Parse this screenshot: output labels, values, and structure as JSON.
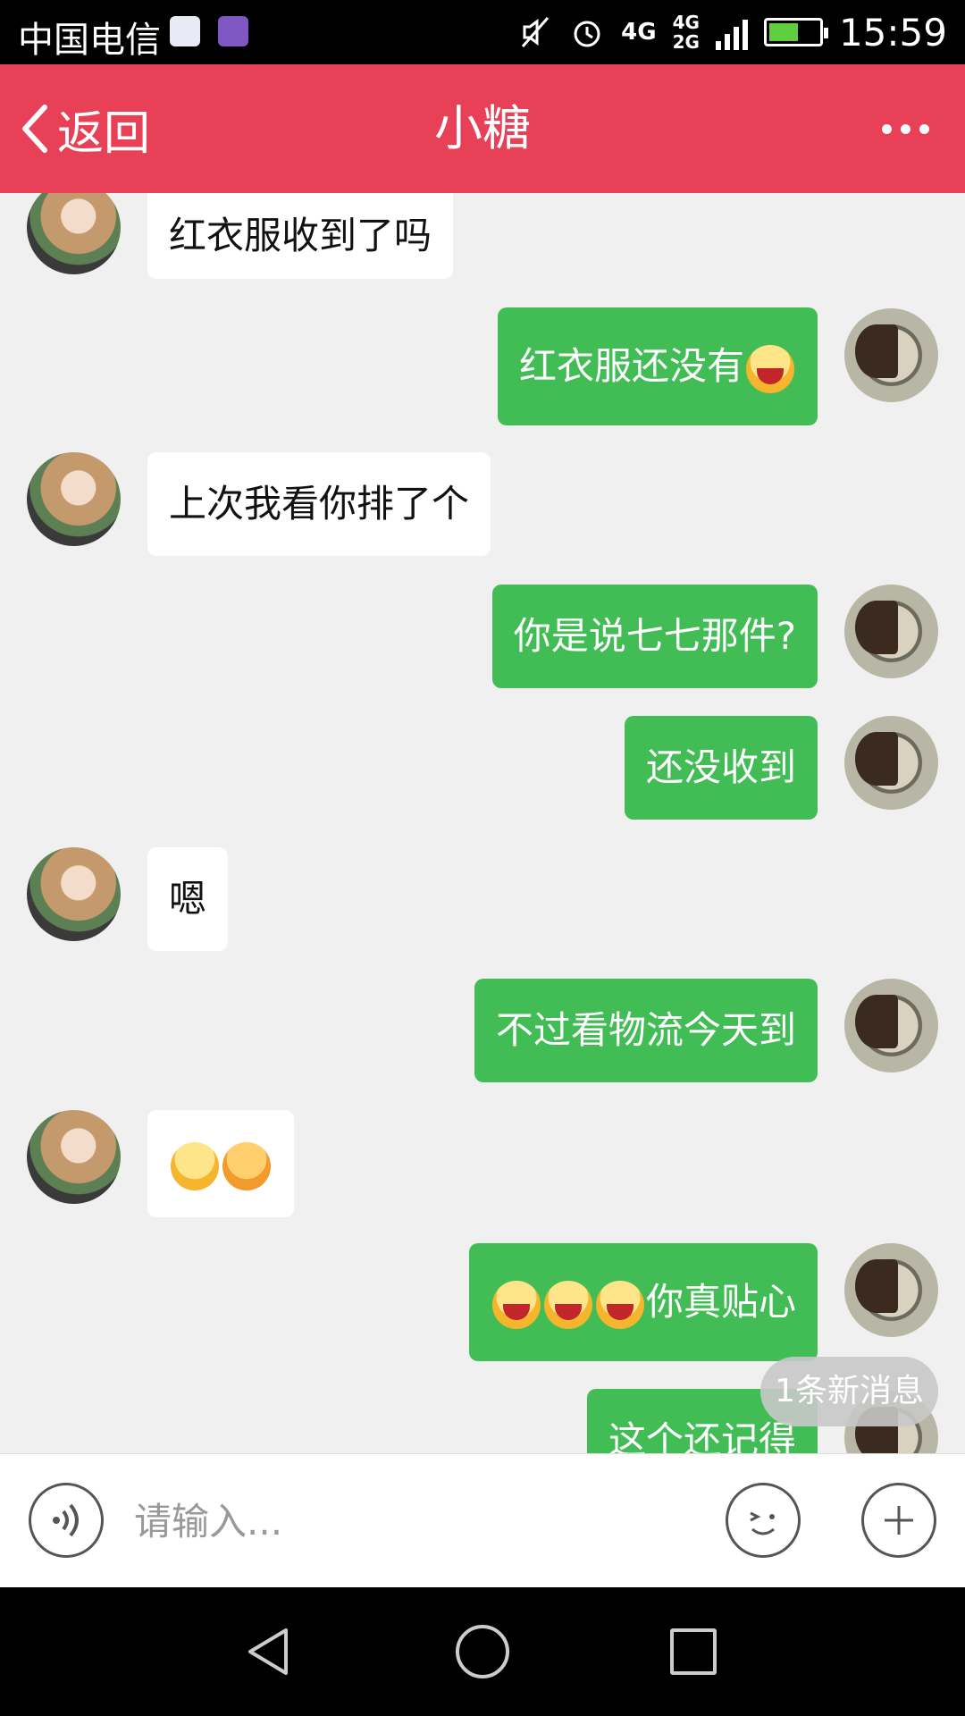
{
  "status_bar": {
    "carrier": "中国电信",
    "network_primary": "4G",
    "network_secondary_top": "4G",
    "network_secondary_bottom": "2G",
    "time": "15:59",
    "battery_level": 0.6,
    "battery_color": "#5fcf3f",
    "icons": [
      "baidu-app-icon",
      "gallery-app-icon",
      "mute-icon",
      "alarm-icon",
      "signal-icon",
      "battery-charging-icon"
    ]
  },
  "header": {
    "back_label": "返回",
    "title": "小糖",
    "background_color": "#e84057"
  },
  "messages": [
    {
      "sender": "her",
      "text": "红衣服收到了吗"
    },
    {
      "sender": "me",
      "text": "红衣服还没有",
      "emojis": [
        "laugh"
      ]
    },
    {
      "sender": "her",
      "text": "上次我看你排了个"
    },
    {
      "sender": "me",
      "text": "你是说七七那件?"
    },
    {
      "sender": "me",
      "text": "还没收到"
    },
    {
      "sender": "her",
      "text": "嗯"
    },
    {
      "sender": "me",
      "text": "不过看物流今天到"
    },
    {
      "sender": "her",
      "text": "",
      "emojis": [
        "wink",
        "blush"
      ]
    },
    {
      "sender": "me",
      "text": "你真贴心",
      "emojis_before": [
        "laugh",
        "laugh",
        "laugh"
      ]
    },
    {
      "sender": "me",
      "text": "这个还记得"
    }
  ],
  "new_message_badge": "1条新消息",
  "input": {
    "placeholder": "请输入..."
  },
  "colors": {
    "my_bubble": "#42bd56",
    "her_bubble": "#ffffff",
    "chat_background": "#f0f0f0"
  }
}
